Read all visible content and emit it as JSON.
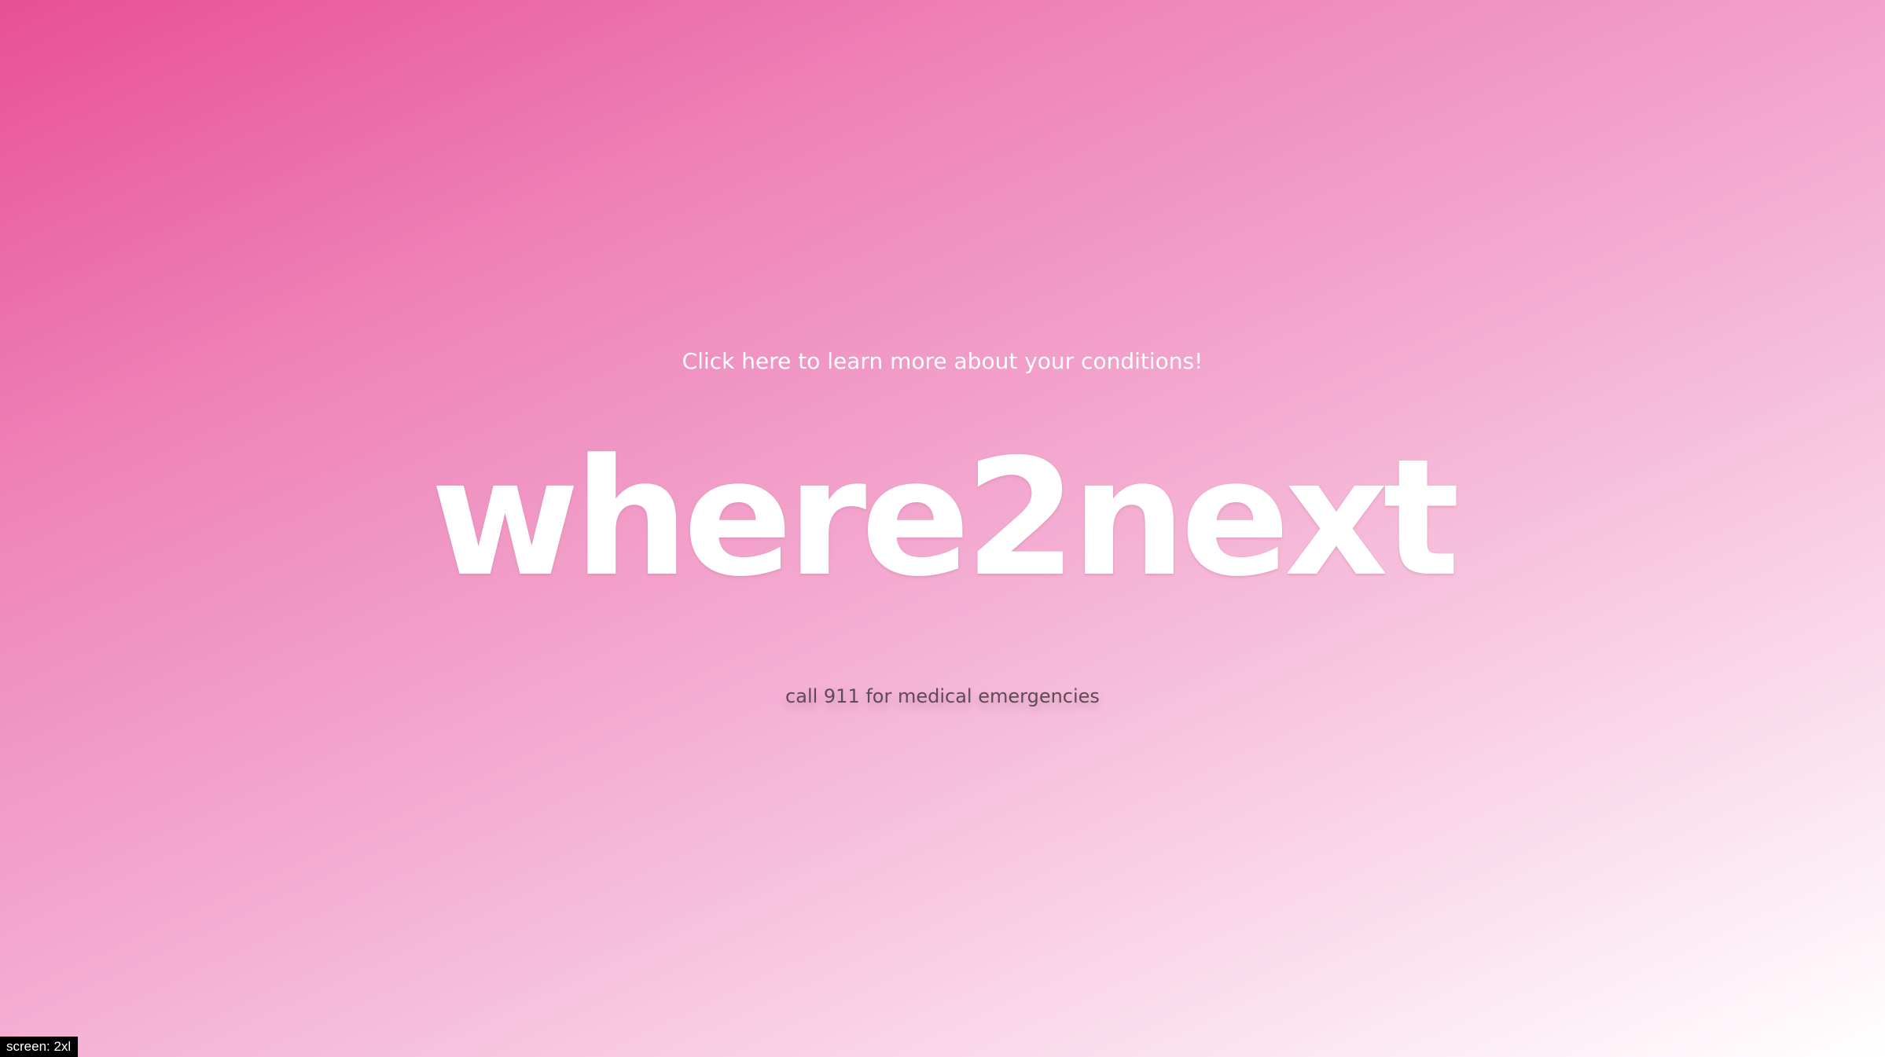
{
  "header": {
    "cta_link": "Click here to learn more about your conditions!"
  },
  "main": {
    "logo_text": "where2next",
    "emergency_notice": "call 911 for medical emergencies"
  },
  "debug": {
    "screen_badge": "screen: 2xl"
  },
  "colors": {
    "gradient_start": "#e84f97",
    "gradient_end": "#ffffff",
    "text_primary": "#ffffff",
    "text_muted": "#5f4a58"
  }
}
